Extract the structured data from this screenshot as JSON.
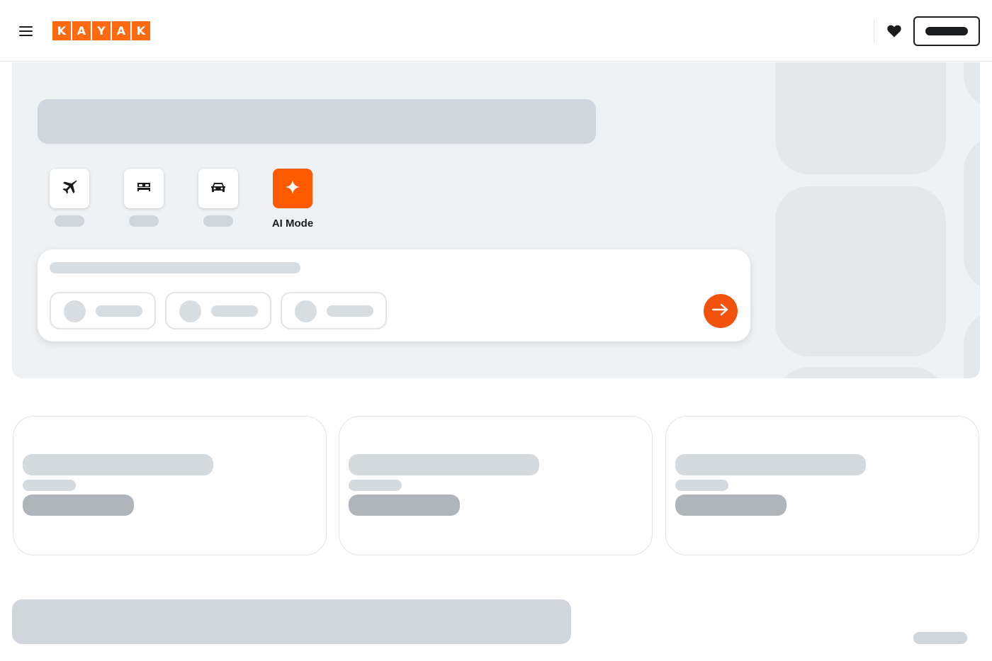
{
  "header": {
    "menu_icon": "hamburger-menu-icon",
    "logo_letters": [
      "K",
      "A",
      "Y",
      "A",
      "K"
    ],
    "favorites_icon": "heart-icon",
    "brand_color": "#ff690f"
  },
  "verticals": [
    {
      "icon": "airplane-icon"
    },
    {
      "icon": "bed-icon"
    },
    {
      "icon": "car-icon"
    },
    {
      "icon": "sparkle-icon",
      "label": "AI Mode",
      "accent": "#ff5a00"
    }
  ],
  "search": {
    "submit_icon": "arrow-right-icon",
    "submit_color": "#f2520c"
  }
}
